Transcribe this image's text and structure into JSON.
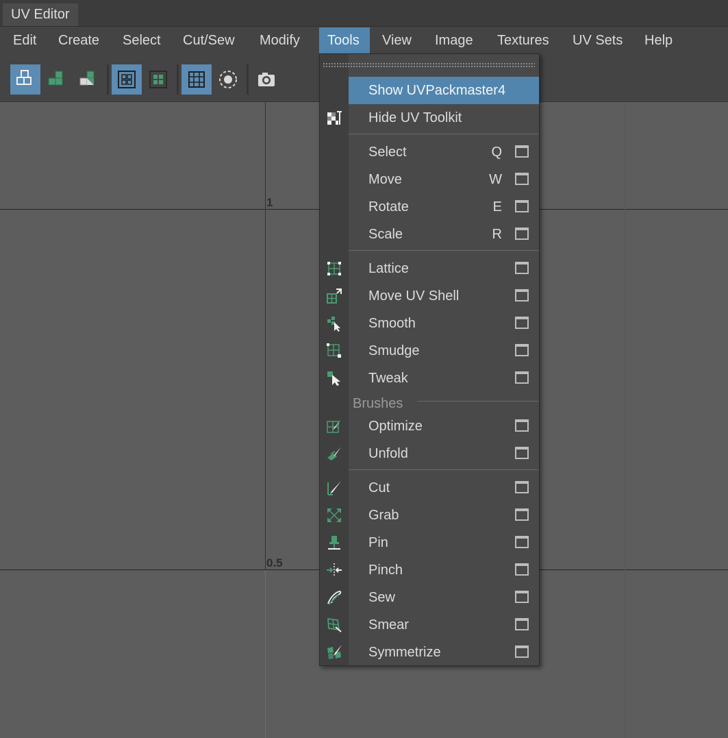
{
  "window": {
    "title": "UV Editor"
  },
  "menubar": {
    "items": [
      {
        "label": "Edit",
        "active": false
      },
      {
        "label": "Create",
        "active": false
      },
      {
        "label": "Select",
        "active": false
      },
      {
        "label": "Cut/Sew",
        "active": false
      },
      {
        "label": "Modify",
        "active": false
      },
      {
        "label": "Tools",
        "active": true
      },
      {
        "label": "View",
        "active": false
      },
      {
        "label": "Image",
        "active": false
      },
      {
        "label": "Textures",
        "active": false
      },
      {
        "label": "UV Sets",
        "active": false
      },
      {
        "label": "Help",
        "active": false
      }
    ]
  },
  "toolbar": {
    "buttons": [
      {
        "icon": "uv-shell-select-icon",
        "active": true
      },
      {
        "icon": "uv-select-green-icon",
        "active": false
      },
      {
        "icon": "uv-select-partial-icon",
        "active": false
      },
      {
        "icon": "texture-borders-icon",
        "active": true
      },
      {
        "icon": "shaded-uv-icon",
        "active": false
      },
      {
        "icon": "grid-display-icon",
        "active": true
      },
      {
        "icon": "distortion-circle-icon",
        "active": false
      },
      {
        "icon": "snapshot-camera-icon",
        "active": false
      }
    ]
  },
  "viewport": {
    "axis_labels": {
      "top": "1",
      "middle": "0.5"
    },
    "colors": {
      "u_axis": "#1e1ed8",
      "v_axis": "#1ea81e",
      "grid": "#262626"
    }
  },
  "dropdown": {
    "items": [
      {
        "label": "Show UVPackmaster4",
        "highlighted": true
      },
      {
        "label": "Hide UV Toolkit",
        "icon": "uv-toolkit-icon"
      },
      {
        "label": "Select",
        "shortcut": "Q",
        "option_box": true
      },
      {
        "label": "Move",
        "shortcut": "W",
        "option_box": true
      },
      {
        "label": "Rotate",
        "shortcut": "E",
        "option_box": true
      },
      {
        "label": "Scale",
        "shortcut": "R",
        "option_box": true
      },
      {
        "label": "Lattice",
        "icon": "lattice-icon",
        "option_box": true
      },
      {
        "label": "Move UV Shell",
        "icon": "move-uv-shell-icon",
        "option_box": true
      },
      {
        "label": "Smooth",
        "icon": "smooth-icon",
        "option_box": true
      },
      {
        "label": "Smudge",
        "icon": "smudge-icon",
        "option_box": true
      },
      {
        "label": "Tweak",
        "icon": "tweak-icon",
        "option_box": true
      },
      {
        "label": "Optimize",
        "icon": "optimize-brush-icon",
        "option_box": true
      },
      {
        "label": "Unfold",
        "icon": "unfold-brush-icon",
        "option_box": true
      },
      {
        "label": "Cut",
        "icon": "cut-brush-icon",
        "option_box": true
      },
      {
        "label": "Grab",
        "icon": "grab-brush-icon",
        "option_box": true
      },
      {
        "label": "Pin",
        "icon": "pin-brush-icon",
        "option_box": true
      },
      {
        "label": "Pinch",
        "icon": "pinch-brush-icon",
        "option_box": true
      },
      {
        "label": "Sew",
        "icon": "sew-brush-icon",
        "option_box": true
      },
      {
        "label": "Smear",
        "icon": "smear-brush-icon",
        "option_box": true
      },
      {
        "label": "Symmetrize",
        "icon": "symmetrize-brush-icon",
        "option_box": true
      }
    ],
    "section_label": "Brushes"
  },
  "colors": {
    "highlight": "#5185ad",
    "background": "#5d5d5d",
    "menu_bg": "#444444"
  }
}
